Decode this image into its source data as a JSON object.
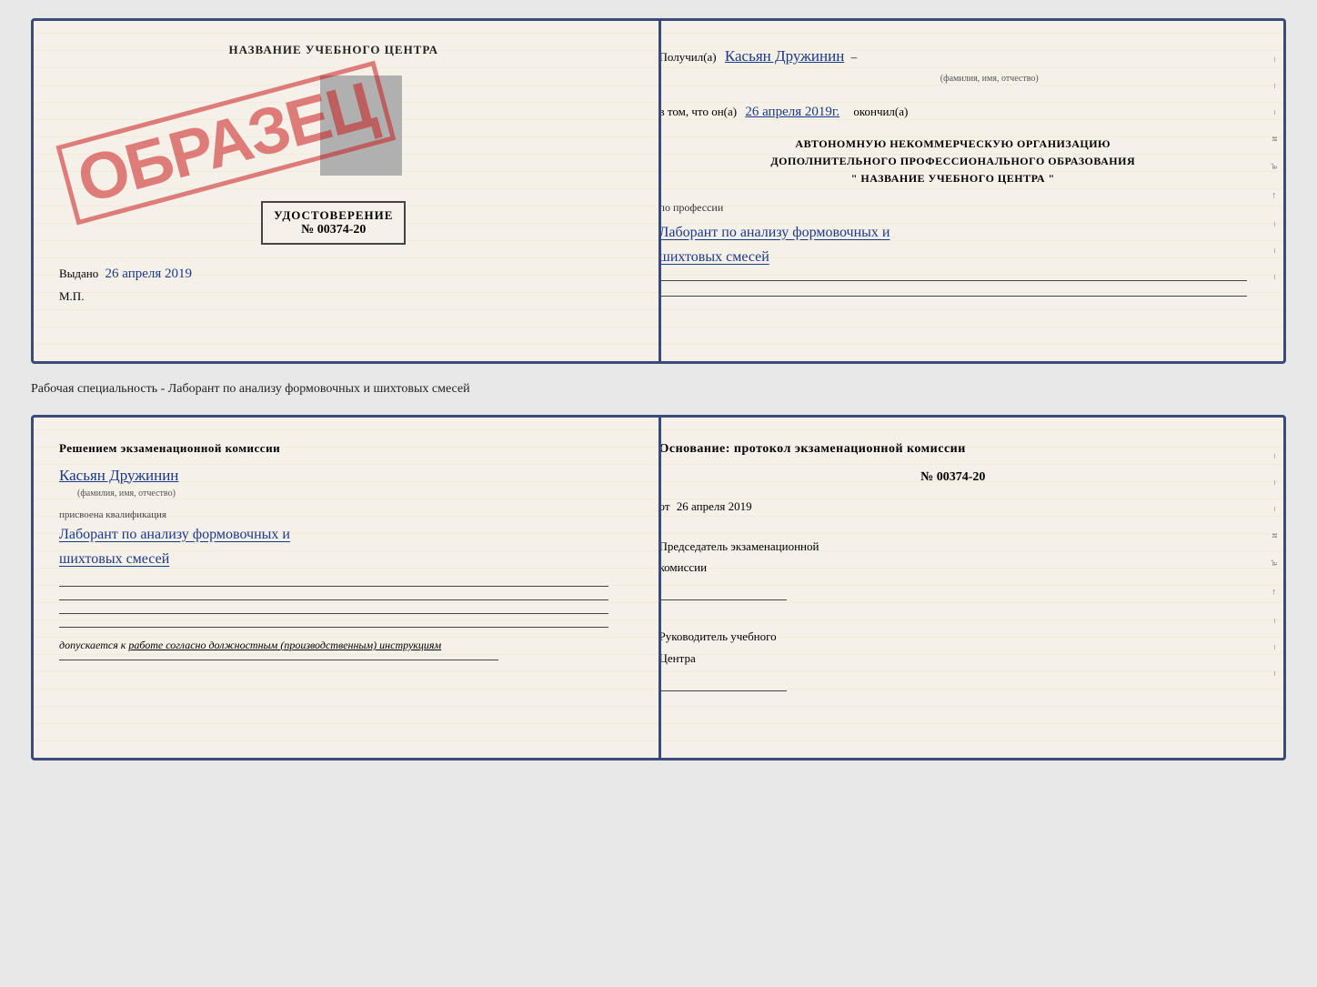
{
  "upper_card": {
    "left": {
      "title": "НАЗВАНИЕ УЧЕБНОГО ЦЕНТРА",
      "stamp_text": "ОБРАЗЕЦ",
      "udost_label": "УДОСТОВЕРЕНИЕ",
      "udost_number": "№ 00374-20",
      "vydano_label": "Выдано",
      "vydano_date": "26 апреля 2019",
      "mp_label": "М.П."
    },
    "right": {
      "poluchil_label": "Получил(a)",
      "name_handwrite": "Касьян Дружинин",
      "name_subtitle": "(фамилия, имя, отчество)",
      "vtom_label": "в том, что он(а)",
      "vtom_date": "26 апреля 2019г.",
      "okonchil_label": "окончил(а)",
      "org_line1": "АВТОНОМНУЮ НЕКОММЕРЧЕСКУЮ ОРГАНИЗАЦИЮ",
      "org_line2": "ДОПОЛНИТЕЛЬНОГО ПРОФЕССИОНАЛЬНОГО ОБРАЗОВАНИЯ",
      "org_line3": "\"  НАЗВАНИЕ УЧЕБНОГО ЦЕНТРА  \"",
      "po_professii_label": "по профессии",
      "profession_line1": "Лаборант по анализу формовочных и",
      "profession_line2": "шихтовых смесей",
      "edge_labels": [
        "–",
        "–",
        "–",
        "и",
        ",а",
        "←",
        "–",
        "–",
        "–"
      ]
    }
  },
  "between_text": "Рабочая специальность - Лаборант по анализу формовочных и шихтовых смесей",
  "lower_card": {
    "left": {
      "resheniem_label": "Решением экзаменационной комиссии",
      "name_handwrite": "Касьян Дружинин",
      "name_subtitle": "(фамилия, имя, отчество)",
      "prisvoena_label": "присвоена квалификация",
      "qual_line1": "Лаборант по анализу формовочных и",
      "qual_line2": "шихтовых смесей",
      "допуск_prefix": "допускается к",
      "допуск_text": "работе согласно должностным (производственным) инструкциям"
    },
    "right": {
      "osnovanie_label": "Основание: протокол экзаменационной комиссии",
      "number": "№ 00374-20",
      "ot_label": "от",
      "ot_date": "26 апреля 2019",
      "predsedatel_line1": "Председатель экзаменационной",
      "predsedatel_line2": "комиссии",
      "rukovoditel_line1": "Руководитель учебного",
      "rukovoditel_line2": "Центра",
      "edge_labels": [
        "–",
        "–",
        "–",
        "и",
        ",а",
        "←",
        "–",
        "–",
        "–"
      ]
    }
  }
}
